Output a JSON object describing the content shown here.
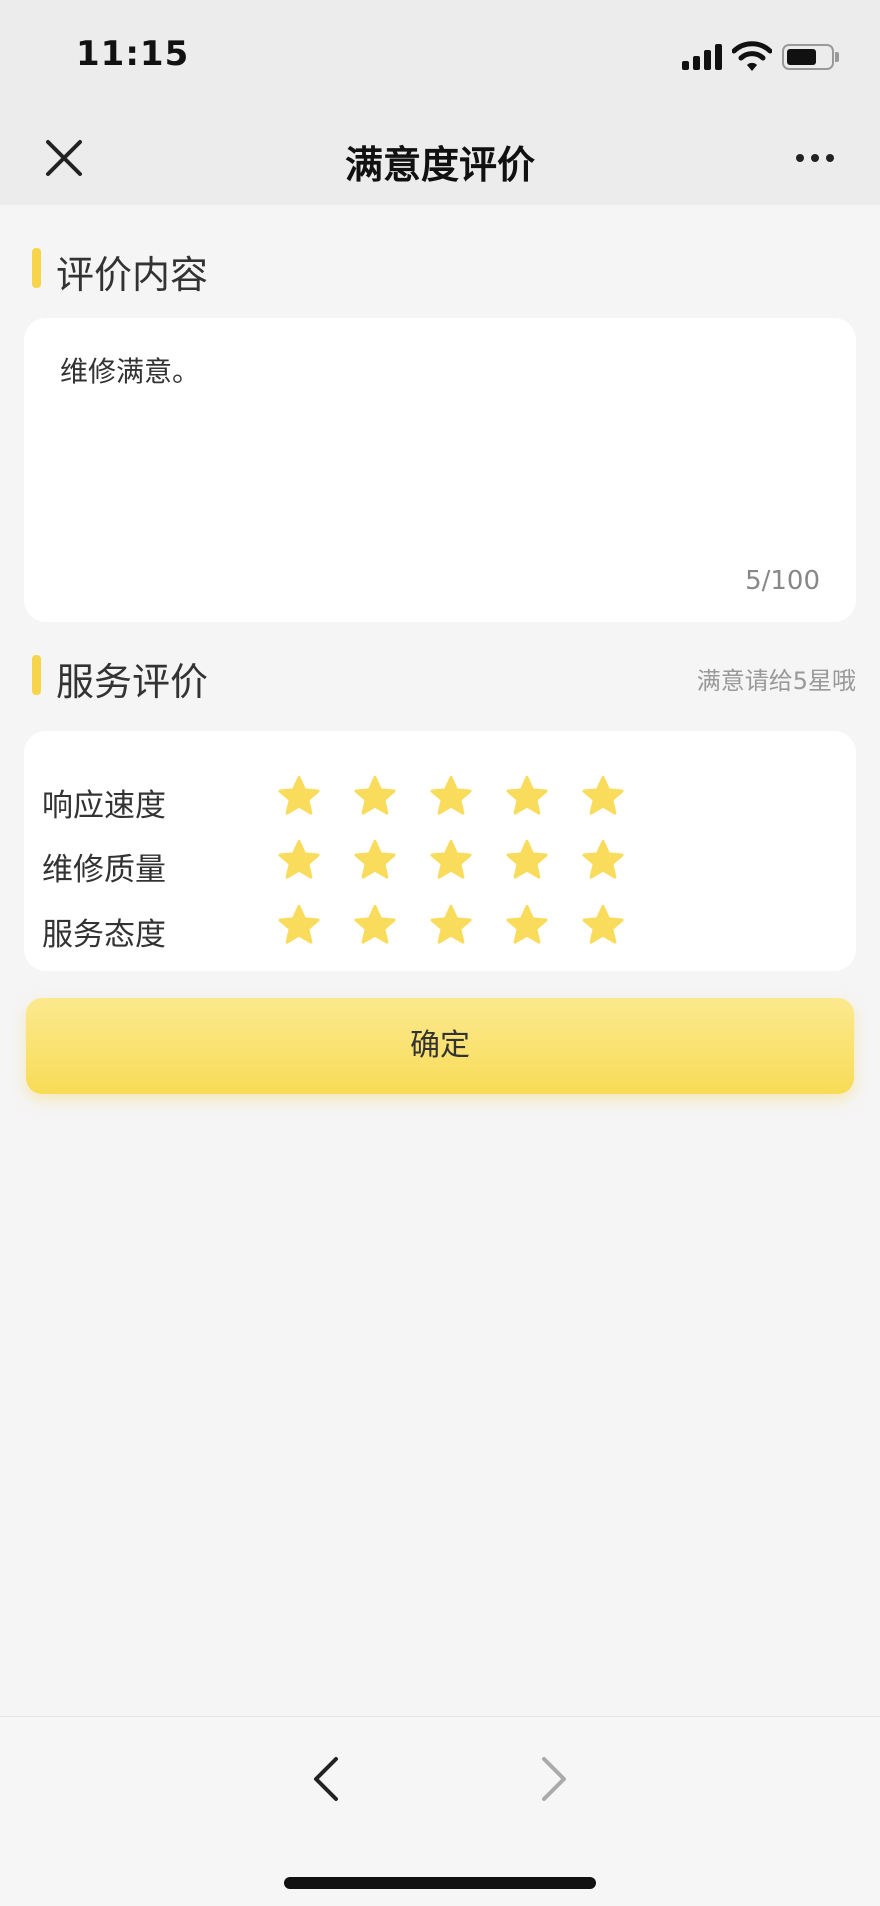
{
  "status_bar": {
    "time": "11:15"
  },
  "nav": {
    "title": "满意度评价",
    "close_icon": "close-icon",
    "more_icon": "more-dots-icon"
  },
  "comment_section": {
    "title": "评价内容",
    "text": "维修满意。",
    "counter": "5/100"
  },
  "service_section": {
    "title": "服务评价",
    "hint": "满意请给5星哦",
    "ratings": [
      {
        "label": "响应速度",
        "stars": 5,
        "max": 5
      },
      {
        "label": "维修质量",
        "stars": 5,
        "max": 5
      },
      {
        "label": "服务态度",
        "stars": 5,
        "max": 5
      }
    ]
  },
  "confirm_button": {
    "label": "确定"
  },
  "colors": {
    "accent": "#f7d54a",
    "star": "#f9dc5c",
    "background": "#f5f5f5"
  }
}
